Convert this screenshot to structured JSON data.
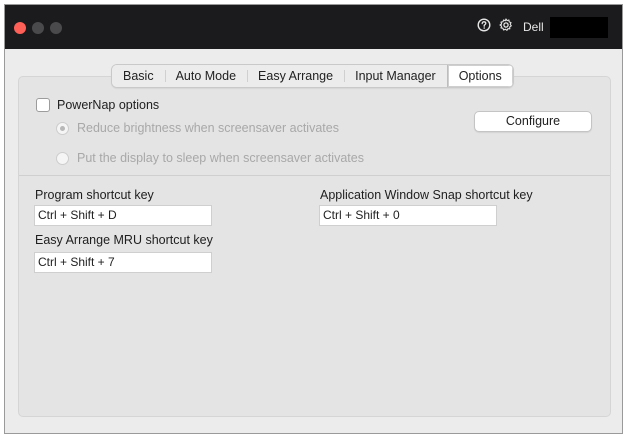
{
  "titlebar": {
    "brand": "Dell",
    "icons": [
      "help-icon",
      "gear-icon"
    ]
  },
  "tabs": [
    {
      "label": "Basic",
      "active": false
    },
    {
      "label": "Auto Mode",
      "active": false
    },
    {
      "label": "Easy Arrange",
      "active": false
    },
    {
      "label": "Input Manager",
      "active": false
    },
    {
      "label": "Options",
      "active": true
    }
  ],
  "powernap": {
    "label": "PowerNap options",
    "checked": false,
    "options": [
      {
        "label": "Reduce brightness when screensaver activates",
        "selected": true,
        "enabled": false
      },
      {
        "label": "Put the display to sleep when screensaver activates",
        "selected": false,
        "enabled": false
      }
    ],
    "configure_label": "Configure"
  },
  "shortcuts": {
    "program": {
      "label": "Program shortcut key",
      "value": "Ctrl + Shift + D"
    },
    "snap": {
      "label": "Application Window Snap shortcut key",
      "value": "Ctrl + Shift + 0"
    },
    "mru": {
      "label": "Easy Arrange MRU shortcut key",
      "value": "Ctrl + Shift + 7"
    }
  },
  "colors": {
    "close": "#fe5f57",
    "titlebar": "#1b1b1d"
  }
}
